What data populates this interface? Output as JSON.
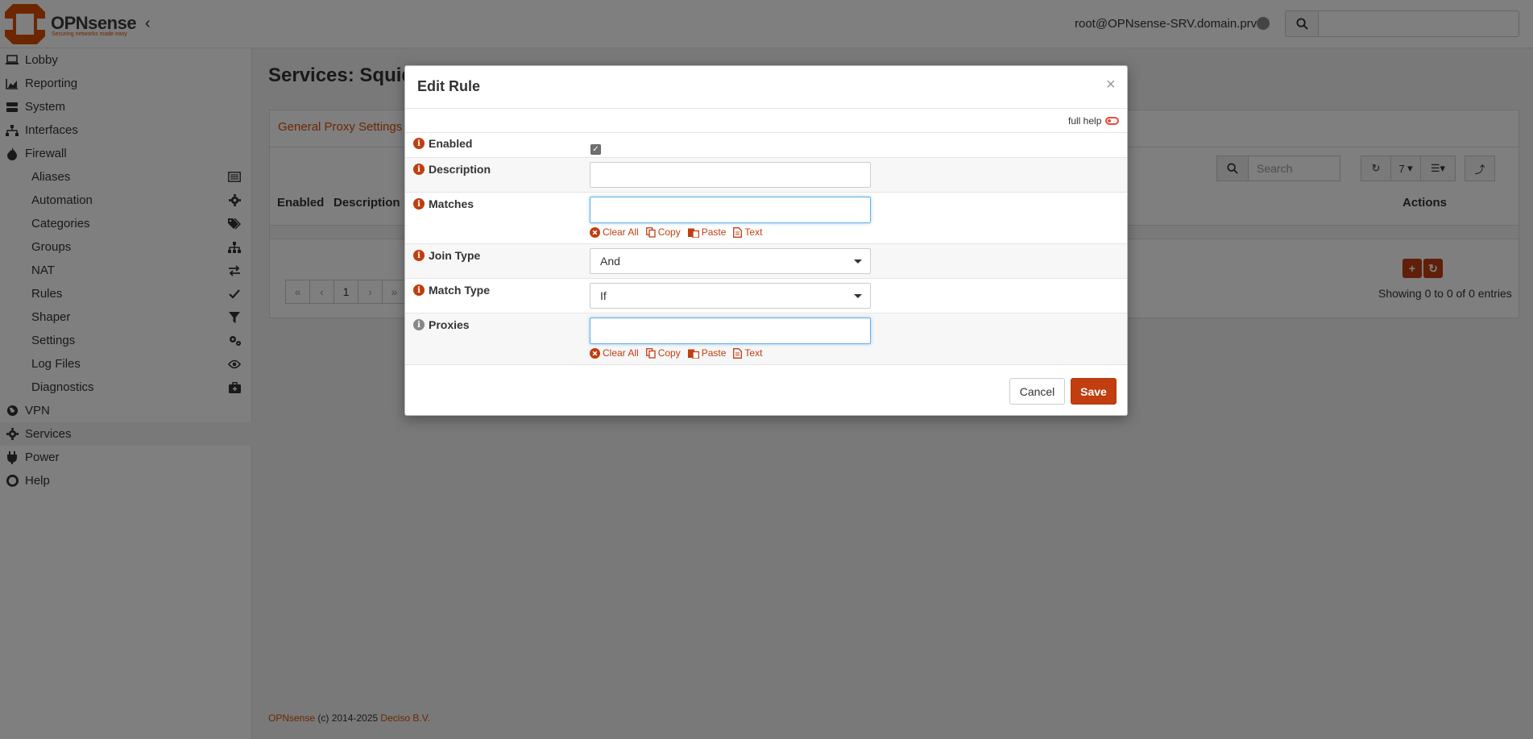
{
  "header": {
    "brand": "OPNsense",
    "brand_tagline": "Securing networks made easy",
    "user": "root@OPNsense-SRV.domain.prv",
    "search_placeholder": ""
  },
  "sidebar": {
    "items": [
      {
        "label": "Lobby",
        "icon": "laptop-icon"
      },
      {
        "label": "Reporting",
        "icon": "area-chart-icon"
      },
      {
        "label": "System",
        "icon": "server-icon"
      },
      {
        "label": "Interfaces",
        "icon": "sitemap-icon"
      },
      {
        "label": "Firewall",
        "icon": "fire-icon"
      },
      {
        "label": "VPN",
        "icon": "globe-icon"
      },
      {
        "label": "Services",
        "icon": "cog-icon"
      },
      {
        "label": "Power",
        "icon": "plug-icon"
      },
      {
        "label": "Help",
        "icon": "lifebuoy-icon"
      }
    ],
    "firewall_sub": [
      {
        "label": "Aliases",
        "icon": "list-alt-icon"
      },
      {
        "label": "Automation",
        "icon": "gear-icon"
      },
      {
        "label": "Categories",
        "icon": "tags-icon"
      },
      {
        "label": "Groups",
        "icon": "sitemap-icon"
      },
      {
        "label": "NAT",
        "icon": "exchange-icon"
      },
      {
        "label": "Rules",
        "icon": "check-icon"
      },
      {
        "label": "Shaper",
        "icon": "filter-icon"
      },
      {
        "label": "Settings",
        "icon": "cogs-icon"
      },
      {
        "label": "Log Files",
        "icon": "eye-icon"
      },
      {
        "label": "Diagnostics",
        "icon": "medkit-icon"
      }
    ]
  },
  "main": {
    "title": "Services: Squid",
    "tab": "General Proxy Settings",
    "grid_search_placeholder": "Search",
    "page_size": "7",
    "columns": {
      "enabled": "Enabled",
      "description": "Description",
      "actions": "Actions"
    },
    "pager": [
      "«",
      "‹",
      "1",
      "›",
      "»"
    ],
    "entries": "Showing 0 to 0 of 0 entries"
  },
  "modal": {
    "title": "Edit Rule",
    "close": "×",
    "full_help": "full help",
    "fields": {
      "enabled": {
        "label": "Enabled",
        "checked": true
      },
      "description": {
        "label": "Description",
        "value": ""
      },
      "matches": {
        "label": "Matches",
        "value": ""
      },
      "join_type": {
        "label": "Join Type",
        "value": "And"
      },
      "match_type": {
        "label": "Match Type",
        "value": "If"
      },
      "proxies": {
        "label": "Proxies",
        "value": ""
      }
    },
    "tools": {
      "clear_all": "Clear All",
      "copy": "Copy",
      "paste": "Paste",
      "text": "Text"
    },
    "cancel": "Cancel",
    "save": "Save"
  },
  "footer": {
    "brand": "OPNsense",
    "copyright": " (c) 2014-2025 ",
    "company": "Deciso B.V."
  },
  "colors": {
    "accent": "#c03e10",
    "link": "#d94f00",
    "overlay": "rgba(0,0,0,0.5)"
  }
}
